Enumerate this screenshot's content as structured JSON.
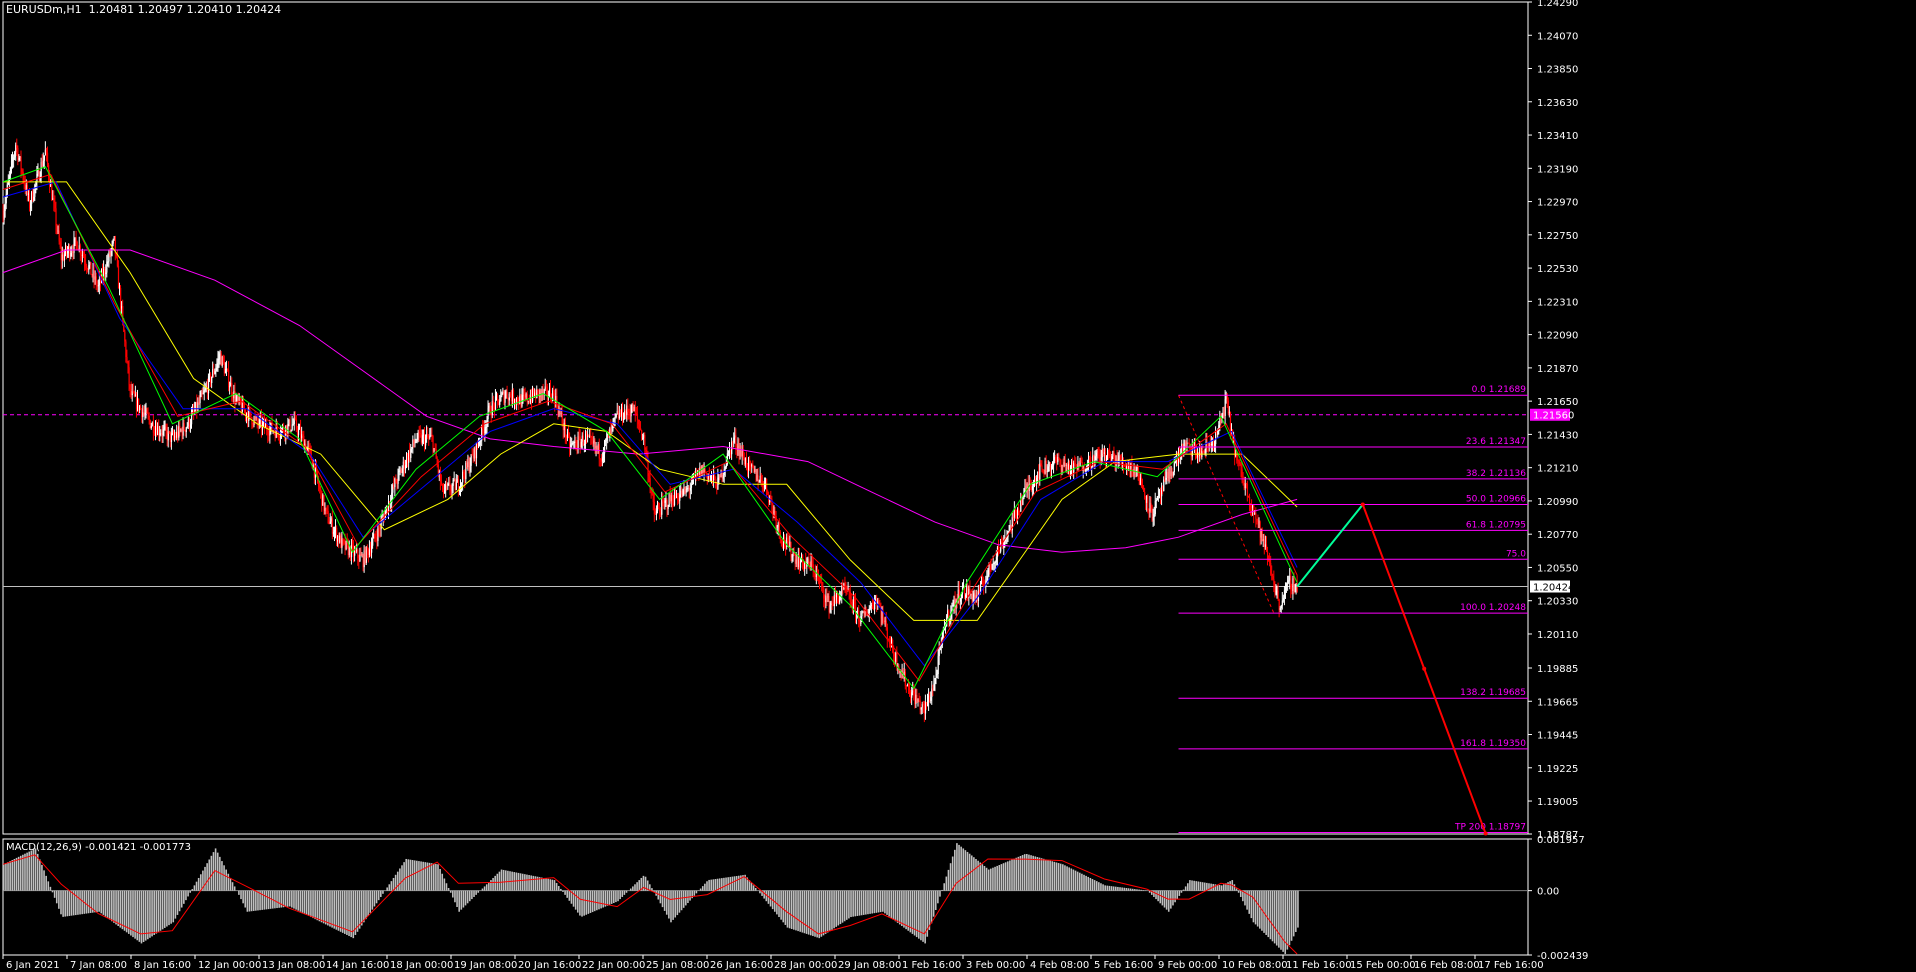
{
  "header": {
    "symbol": "EURUSDm,H1",
    "ohlc": "1.20481 1.20497 1.20410 1.20424"
  },
  "macd": {
    "label": "MACD(12,26,9) -0.001421 -0.001773",
    "axis_labels": [
      "0.001957",
      "0.00",
      "-0.002439"
    ]
  },
  "colors": {
    "background": "#000000",
    "frame": "#ffffff",
    "candle_bull": "#ffffff",
    "candle_bear": "#ff0000",
    "ma_magenta": "#ff00ff",
    "ma_yellow": "#ffff00",
    "ma_blue": "#0000ff",
    "ma_red": "#ff0000",
    "ma_green": "#00ff00",
    "fib": "#ff00ff",
    "projection_up": "#00ff99",
    "projection_down": "#ff0000",
    "macd_hist": "#c0c0c0",
    "macd_signal": "#ff0000"
  },
  "chart_data": {
    "type": "candlestick",
    "symbol": "EURUSD",
    "timeframe": "H1",
    "ylim": [
      1.18787,
      1.2429
    ],
    "price_axis_labels": [
      "1.24290",
      "1.24070",
      "1.23850",
      "1.23630",
      "1.23410",
      "1.23190",
      "1.22970",
      "1.22750",
      "1.22530",
      "1.22310",
      "1.22090",
      "1.21870",
      "1.21650",
      "1.21430",
      "1.21210",
      "1.20990",
      "1.20770",
      "1.20550",
      "1.20330",
      "1.20110",
      "1.19885",
      "1.19665",
      "1.19445",
      "1.19225",
      "1.19005",
      "1.18787"
    ],
    "time_axis_labels": [
      "6 Jan 2021",
      "7 Jan 08:00",
      "8 Jan 16:00",
      "12 Jan 00:00",
      "13 Jan 08:00",
      "14 Jan 16:00",
      "18 Jan 00:00",
      "19 Jan 08:00",
      "20 Jan 16:00",
      "22 Jan 00:00",
      "25 Jan 08:00",
      "26 Jan 16:00",
      "28 Jan 00:00",
      "29 Jan 08:00",
      "1 Feb 16:00",
      "3 Feb 00:00",
      "4 Feb 08:00",
      "5 Feb 16:00",
      "9 Feb 00:00",
      "10 Feb 08:00",
      "11 Feb 16:00",
      "15 Feb 00:00",
      "16 Feb 08:00",
      "17 Feb 16:00"
    ],
    "price_path": [
      [
        0,
        1.229
      ],
      [
        12,
        1.2335
      ],
      [
        25,
        1.2295
      ],
      [
        40,
        1.233
      ],
      [
        55,
        1.226
      ],
      [
        70,
        1.227
      ],
      [
        90,
        1.224
      ],
      [
        105,
        1.227
      ],
      [
        120,
        1.217
      ],
      [
        140,
        1.215
      ],
      [
        160,
        1.214
      ],
      [
        175,
        1.215
      ],
      [
        190,
        1.217
      ],
      [
        205,
        1.2195
      ],
      [
        220,
        1.2165
      ],
      [
        240,
        1.215
      ],
      [
        260,
        1.2145
      ],
      [
        275,
        1.215
      ],
      [
        290,
        1.213
      ],
      [
        305,
        1.209
      ],
      [
        320,
        1.207
      ],
      [
        340,
        1.206
      ],
      [
        355,
        1.208
      ],
      [
        370,
        1.211
      ],
      [
        390,
        1.214
      ],
      [
        405,
        1.214
      ],
      [
        415,
        1.2105
      ],
      [
        430,
        1.211
      ],
      [
        445,
        1.213
      ],
      [
        460,
        1.216
      ],
      [
        475,
        1.217
      ],
      [
        490,
        1.2165
      ],
      [
        505,
        1.217
      ],
      [
        520,
        1.217
      ],
      [
        535,
        1.2135
      ],
      [
        550,
        1.214
      ],
      [
        565,
        1.213
      ],
      [
        580,
        1.2155
      ],
      [
        595,
        1.216
      ],
      [
        605,
        1.214
      ],
      [
        615,
        1.209
      ],
      [
        630,
        1.21
      ],
      [
        645,
        1.2105
      ],
      [
        660,
        1.212
      ],
      [
        675,
        1.211
      ],
      [
        690,
        1.214
      ],
      [
        705,
        1.212
      ],
      [
        720,
        1.211
      ],
      [
        735,
        1.2075
      ],
      [
        750,
        1.206
      ],
      [
        765,
        1.2055
      ],
      [
        780,
        1.203
      ],
      [
        795,
        1.204
      ],
      [
        810,
        1.202
      ],
      [
        825,
        1.2035
      ],
      [
        840,
        1.2
      ],
      [
        855,
        1.1975
      ],
      [
        870,
        1.196
      ],
      [
        880,
        1.198
      ],
      [
        890,
        1.202
      ],
      [
        905,
        1.204
      ],
      [
        920,
        1.2035
      ],
      [
        935,
        1.206
      ],
      [
        950,
        1.208
      ],
      [
        965,
        1.2105
      ],
      [
        980,
        1.212
      ],
      [
        995,
        1.2125
      ],
      [
        1010,
        1.212
      ],
      [
        1025,
        1.2125
      ],
      [
        1040,
        1.213
      ],
      [
        1055,
        1.2125
      ],
      [
        1070,
        1.212
      ],
      [
        1085,
        1.209
      ],
      [
        1100,
        1.2115
      ],
      [
        1115,
        1.2135
      ],
      [
        1130,
        1.213
      ],
      [
        1145,
        1.214
      ],
      [
        1155,
        1.2165
      ],
      [
        1165,
        1.2125
      ],
      [
        1180,
        1.2095
      ],
      [
        1195,
        1.206
      ],
      [
        1205,
        1.203
      ],
      [
        1215,
        1.2045
      ],
      [
        1222,
        1.2042
      ]
    ],
    "horizontal_levels": [
      {
        "price": 1.2156,
        "label": "1.21560",
        "style": "dashed"
      },
      {
        "price": 1.20424,
        "label": "1.20424",
        "style": "solid"
      }
    ],
    "fibonacci": {
      "from": 1.21689,
      "to": 1.20248,
      "levels": [
        {
          "ratio": "0.0",
          "price": 1.21689,
          "label": "0.0 1.21689"
        },
        {
          "ratio": "23.6",
          "price": 1.21347,
          "label": "23.6 1.21347"
        },
        {
          "ratio": "38.2",
          "price": 1.21136,
          "label": "38.2 1.21136"
        },
        {
          "ratio": "50.0",
          "price": 1.20966,
          "label": "50.0 1.20966"
        },
        {
          "ratio": "61.8",
          "price": 1.20795,
          "label": "61.8 1.20795"
        },
        {
          "ratio": "75.0",
          "price": 1.20604,
          "label": "75.0"
        },
        {
          "ratio": "100.0",
          "price": 1.20248,
          "label": "100.0 1.20248"
        },
        {
          "ratio": "138.2",
          "price": 1.19685,
          "label": "138.2 1.19685"
        },
        {
          "ratio": "161.8",
          "price": 1.1935,
          "label": "161.8 1.19350"
        },
        {
          "ratio": "200.0",
          "price": 1.18797,
          "label": "TP 200 1.18797"
        }
      ]
    },
    "projection": [
      {
        "price": 1.20424,
        "color": "projection_up"
      },
      {
        "price": 1.20966,
        "color": "projection_down"
      },
      {
        "price": 1.1988,
        "color": "projection_down"
      },
      {
        "price": 1.1879,
        "color": "projection_down"
      }
    ],
    "moving_averages": [
      {
        "color": "ma_magenta",
        "path": [
          [
            0,
            1.225
          ],
          [
            60,
            1.2265
          ],
          [
            120,
            1.2265
          ],
          [
            200,
            1.2245
          ],
          [
            280,
            1.2215
          ],
          [
            340,
            1.2185
          ],
          [
            400,
            1.2155
          ],
          [
            460,
            1.214
          ],
          [
            520,
            1.2135
          ],
          [
            600,
            1.213
          ],
          [
            680,
            1.2135
          ],
          [
            760,
            1.2125
          ],
          [
            820,
            1.2105
          ],
          [
            880,
            1.2085
          ],
          [
            940,
            1.207
          ],
          [
            1000,
            1.2065
          ],
          [
            1060,
            1.2068
          ],
          [
            1110,
            1.2075
          ],
          [
            1170,
            1.209
          ],
          [
            1222,
            1.21
          ]
        ]
      },
      {
        "color": "ma_yellow",
        "path": [
          [
            0,
            1.231
          ],
          [
            60,
            1.231
          ],
          [
            120,
            1.225
          ],
          [
            180,
            1.218
          ],
          [
            240,
            1.215
          ],
          [
            300,
            1.213
          ],
          [
            360,
            1.208
          ],
          [
            420,
            1.21
          ],
          [
            470,
            1.213
          ],
          [
            520,
            1.215
          ],
          [
            570,
            1.2145
          ],
          [
            620,
            1.212
          ],
          [
            680,
            1.211
          ],
          [
            740,
            1.211
          ],
          [
            800,
            1.206
          ],
          [
            860,
            1.202
          ],
          [
            920,
            1.202
          ],
          [
            960,
            1.206
          ],
          [
            1000,
            1.21
          ],
          [
            1050,
            1.2125
          ],
          [
            1110,
            1.213
          ],
          [
            1170,
            1.213
          ],
          [
            1222,
            1.2095
          ]
        ]
      },
      {
        "color": "ma_blue",
        "path": [
          [
            0,
            1.23
          ],
          [
            50,
            1.231
          ],
          [
            110,
            1.222
          ],
          [
            170,
            1.216
          ],
          [
            230,
            1.216
          ],
          [
            290,
            1.213
          ],
          [
            340,
            1.2075
          ],
          [
            400,
            1.211
          ],
          [
            460,
            1.2145
          ],
          [
            520,
            1.216
          ],
          [
            580,
            1.215
          ],
          [
            630,
            1.211
          ],
          [
            690,
            1.212
          ],
          [
            750,
            1.2085
          ],
          [
            810,
            1.2045
          ],
          [
            870,
            1.199
          ],
          [
            920,
            1.2035
          ],
          [
            980,
            1.21
          ],
          [
            1040,
            1.2125
          ],
          [
            1100,
            1.2125
          ],
          [
            1160,
            1.2145
          ],
          [
            1222,
            1.2055
          ]
        ]
      },
      {
        "color": "ma_red",
        "path": [
          [
            0,
            1.2305
          ],
          [
            45,
            1.2315
          ],
          [
            105,
            1.223
          ],
          [
            165,
            1.2155
          ],
          [
            225,
            1.2165
          ],
          [
            285,
            1.2135
          ],
          [
            335,
            1.207
          ],
          [
            395,
            1.2115
          ],
          [
            455,
            1.215
          ],
          [
            515,
            1.2165
          ],
          [
            575,
            1.215
          ],
          [
            625,
            1.2105
          ],
          [
            685,
            1.2125
          ],
          [
            745,
            1.2075
          ],
          [
            805,
            1.2035
          ],
          [
            865,
            1.198
          ],
          [
            915,
            1.204
          ],
          [
            975,
            1.2105
          ],
          [
            1035,
            1.2125
          ],
          [
            1095,
            1.212
          ],
          [
            1155,
            1.215
          ],
          [
            1222,
            1.205
          ]
        ]
      },
      {
        "color": "ma_green",
        "path": [
          [
            0,
            1.231
          ],
          [
            40,
            1.232
          ],
          [
            100,
            1.224
          ],
          [
            160,
            1.215
          ],
          [
            220,
            1.217
          ],
          [
            280,
            1.214
          ],
          [
            330,
            1.2065
          ],
          [
            390,
            1.212
          ],
          [
            450,
            1.2155
          ],
          [
            510,
            1.217
          ],
          [
            570,
            1.2145
          ],
          [
            620,
            1.21
          ],
          [
            680,
            1.213
          ],
          [
            740,
            1.207
          ],
          [
            800,
            1.203
          ],
          [
            860,
            1.1975
          ],
          [
            910,
            1.2045
          ],
          [
            970,
            1.211
          ],
          [
            1030,
            1.2125
          ],
          [
            1090,
            1.2115
          ],
          [
            1150,
            1.2155
          ],
          [
            1222,
            1.2045
          ]
        ]
      }
    ],
    "macd_path": [
      [
        0,
        0.001
      ],
      [
        30,
        0.0016
      ],
      [
        55,
        -0.001
      ],
      [
        90,
        -0.0008
      ],
      [
        130,
        -0.002
      ],
      [
        160,
        -0.0012
      ],
      [
        200,
        0.0016
      ],
      [
        230,
        -0.0008
      ],
      [
        270,
        -0.0006
      ],
      [
        330,
        -0.0018
      ],
      [
        380,
        0.0012
      ],
      [
        410,
        0.001
      ],
      [
        430,
        -0.0008
      ],
      [
        470,
        0.0008
      ],
      [
        520,
        0.0004
      ],
      [
        545,
        -0.001
      ],
      [
        580,
        -0.0004
      ],
      [
        605,
        0.0006
      ],
      [
        630,
        -0.0012
      ],
      [
        665,
        0.0004
      ],
      [
        700,
        0.0006
      ],
      [
        740,
        -0.0014
      ],
      [
        770,
        -0.0018
      ],
      [
        800,
        -0.001
      ],
      [
        830,
        -0.0008
      ],
      [
        870,
        -0.002
      ],
      [
        900,
        0.0018
      ],
      [
        930,
        0.0008
      ],
      [
        965,
        0.0014
      ],
      [
        1000,
        0.001
      ],
      [
        1040,
        0.0002
      ],
      [
        1080,
        0.0
      ],
      [
        1100,
        -0.0008
      ],
      [
        1120,
        0.0004
      ],
      [
        1150,
        0.0002
      ],
      [
        1160,
        0.0004
      ],
      [
        1180,
        -0.0012
      ],
      [
        1210,
        -0.0024
      ],
      [
        1222,
        -0.0014
      ]
    ],
    "macd_ylim": [
      -0.002439,
      0.001957
    ]
  }
}
